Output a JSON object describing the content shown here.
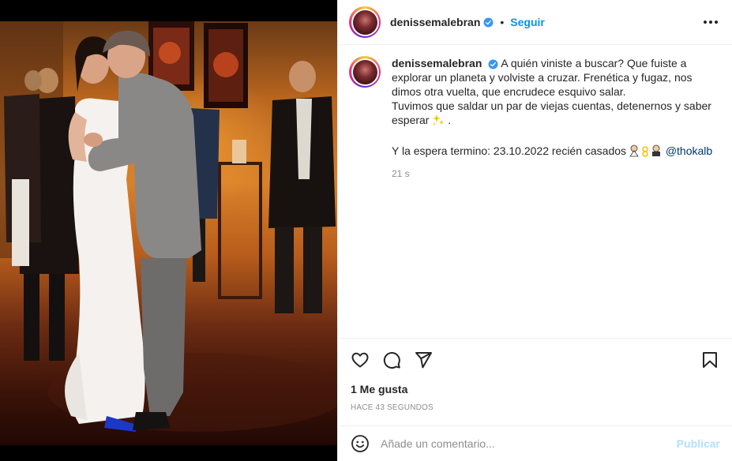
{
  "post": {
    "author": "denissemalebran",
    "follow_label": "Seguir",
    "separator": "•",
    "caption_lines": [
      "A quién viniste a buscar? Que fuiste a",
      "explorar un planeta y volviste a cruzar. Frenética y fugaz, nos",
      "dimos otra vuelta, que encrudece esquivo salar.",
      "Tuvimos que saldar un par de viejas cuentas, detenernos y saber",
      "esperar",
      "Y la espera termino: 23.10.2022 recién casados"
    ],
    "caption_end_punct": ".",
    "mention": "@thokalb",
    "caption_time": "21 s",
    "likes": "1 Me gusta",
    "posted_ago": "HACE 43 SEGUNDOS",
    "comment_placeholder": "Añade un comentario...",
    "publish_label": "Publicar"
  },
  "icons": {
    "verified": "verified-badge-icon",
    "more": "more-options-icon",
    "like": "heart-icon",
    "comment": "comment-icon",
    "share": "send-icon",
    "save": "bookmark-icon",
    "emoji": "emoji-icon",
    "sparkles": "sparkles-emoji",
    "couple": "couple-emoji"
  },
  "colors": {
    "accent": "#0095f6",
    "text": "#262626",
    "muted": "#8e8e8e",
    "mention": "#00376b",
    "publish_disabled": "#b2dffc",
    "verified": "#3897f0"
  }
}
